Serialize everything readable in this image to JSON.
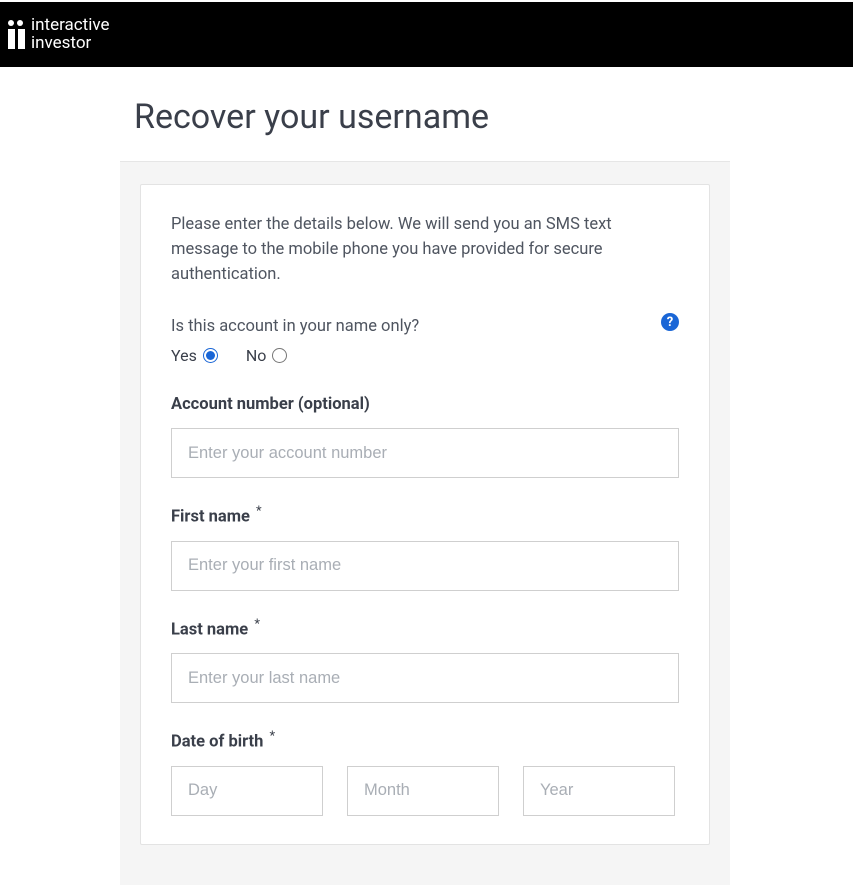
{
  "brand": {
    "line1": "interactive",
    "line2": "investor"
  },
  "page": {
    "title": "Recover your username",
    "intro": "Please enter the details below. We will send you an SMS text message to the mobile phone you have provided for secure authentication."
  },
  "form": {
    "name_only_question": "Is this account in your name only?",
    "name_only_yes": "Yes",
    "name_only_no": "No",
    "name_only_selected": "yes",
    "account_number_label": "Account number (optional)",
    "account_number_placeholder": "Enter your account number",
    "first_name_label": "First name",
    "first_name_placeholder": "Enter your first name",
    "last_name_label": "Last name",
    "last_name_placeholder": "Enter your last name",
    "dob_label": "Date of birth",
    "dob_day_placeholder": "Day",
    "dob_month_placeholder": "Month",
    "dob_year_placeholder": "Year",
    "required_mark": "*",
    "help_glyph": "?"
  }
}
